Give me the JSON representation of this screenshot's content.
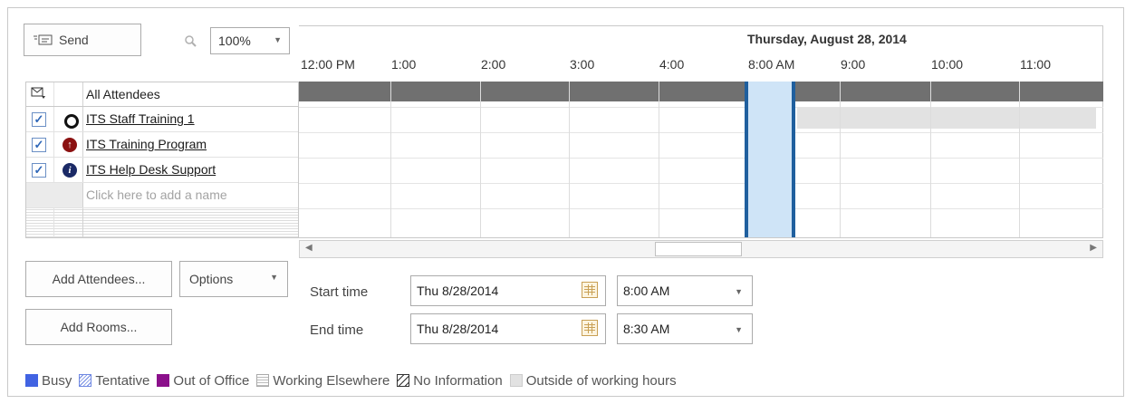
{
  "toolbar": {
    "send_label": "Send",
    "zoom_value": "100%"
  },
  "schedule": {
    "date_label": "Thursday, August 28, 2014",
    "hours": [
      "12:00 PM",
      "1:00",
      "2:00",
      "3:00",
      "4:00",
      "8:00 AM",
      "9:00",
      "10:00",
      "11:00"
    ]
  },
  "attendees": {
    "header": "All Attendees",
    "items": [
      {
        "name": "ITS Staff Training 1",
        "role": "organizer",
        "checked": true
      },
      {
        "name": "ITS Training Program",
        "role": "required",
        "checked": true
      },
      {
        "name": "ITS Help Desk Support",
        "role": "resource",
        "checked": true
      }
    ],
    "add_placeholder": "Click here to add a name"
  },
  "buttons": {
    "add_attendees": "Add Attendees...",
    "options": "Options",
    "add_rooms": "Add Rooms..."
  },
  "times": {
    "start_label": "Start time",
    "start_date": "Thu 8/28/2014",
    "start_time": "8:00 AM",
    "end_label": "End time",
    "end_date": "Thu 8/28/2014",
    "end_time": "8:30 AM"
  },
  "legend": [
    {
      "label": "Busy",
      "color": "#4163e2"
    },
    {
      "label": "Tentative",
      "color": "#6f88e2"
    },
    {
      "label": "Out of Office",
      "color": "#8b108b"
    },
    {
      "label": "Working Elsewhere",
      "color": "#bbbbbb"
    },
    {
      "label": "No Information",
      "color": "#333333"
    },
    {
      "label": "Outside of working hours",
      "color": "#e2e2e2"
    }
  ]
}
